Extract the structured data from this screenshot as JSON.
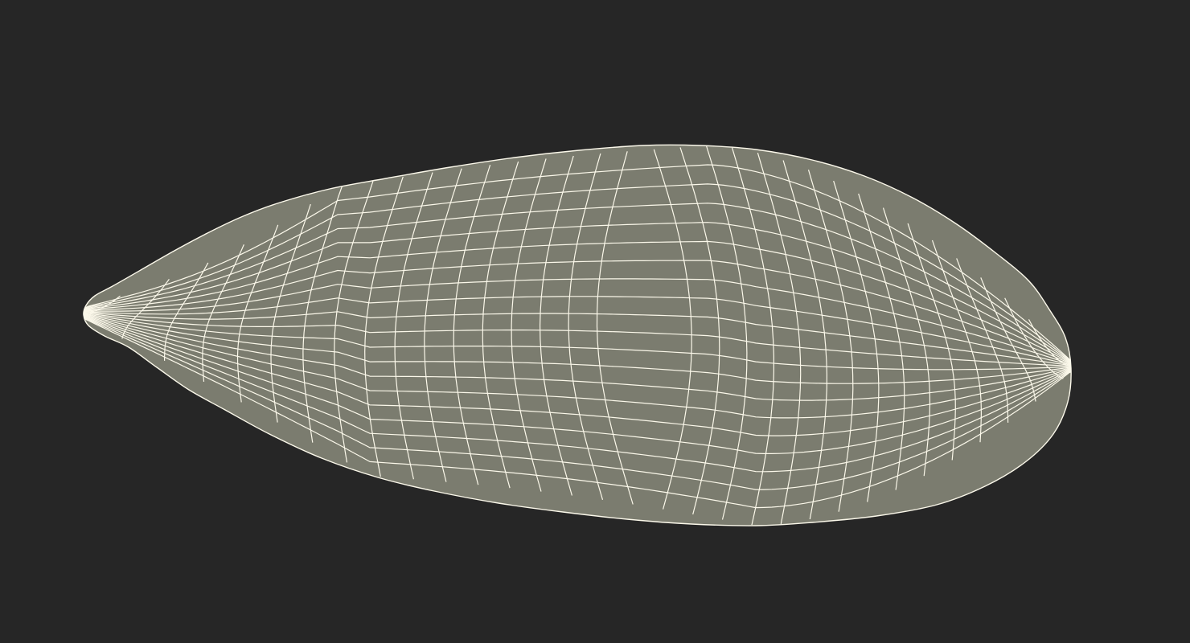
{
  "scene": {
    "subject": "seed-wireframe-mesh",
    "colors": {
      "background": "#262626",
      "surface": "#7b7c6f",
      "wire": "#fbf8ea"
    }
  }
}
